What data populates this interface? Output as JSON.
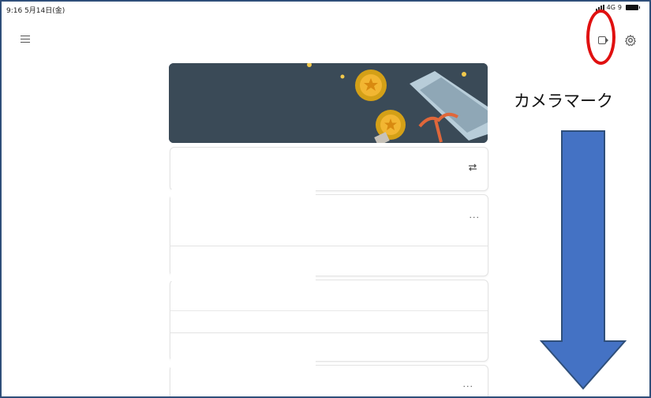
{
  "status_bar": {
    "time": "9:16  5月14日(金)",
    "network": "4G",
    "battery": "9"
  },
  "annotation": {
    "label": "カメラマーク",
    "highlight_color": "#e01010",
    "arrow_color": "#4472c4"
  },
  "toolbar": {
    "menu_icon": "hamburger-menu-icon",
    "camera_icon": "video-camera-icon",
    "settings_icon": "gear-icon"
  },
  "cards": [
    {
      "menu": "···"
    },
    {
      "menu": "···"
    }
  ],
  "colors": {
    "banner_bg": "#3a4a57",
    "frame_border": "#2f4f7a"
  }
}
